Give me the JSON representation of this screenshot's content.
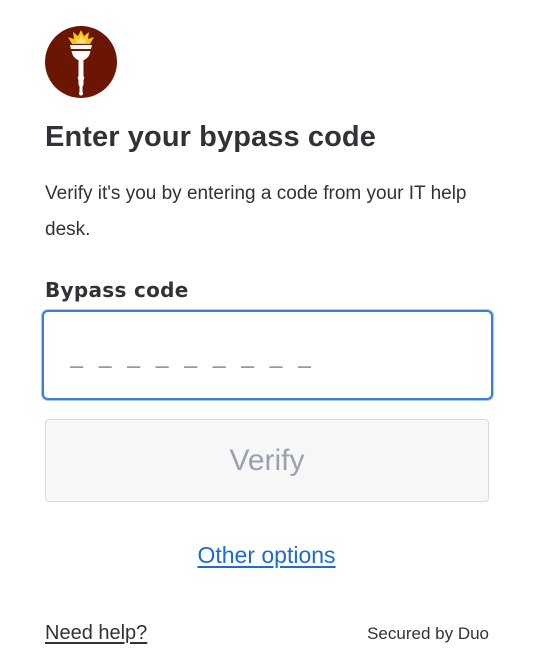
{
  "logo": {
    "icon": "torch-icon",
    "background_color": "#6b1602",
    "flame_color": "#f5c518",
    "handle_color": "#ffffff"
  },
  "heading": {
    "title": "Enter your bypass code",
    "description": "Verify it's you by entering a code from your IT help desk."
  },
  "form": {
    "label": "Bypass code",
    "input_value": "",
    "input_placeholder": "_ _ _ _ _ _ _ _ _",
    "verify_label": "Verify",
    "verify_disabled": true
  },
  "links": {
    "other_options": "Other options"
  },
  "footer": {
    "help": "Need help?",
    "secured_by": "Secured by Duo"
  },
  "colors": {
    "text": "#2f3337",
    "link": "#1f6ad0",
    "focus_border": "#3a7fd5",
    "disabled_text": "#9aa3ad"
  }
}
